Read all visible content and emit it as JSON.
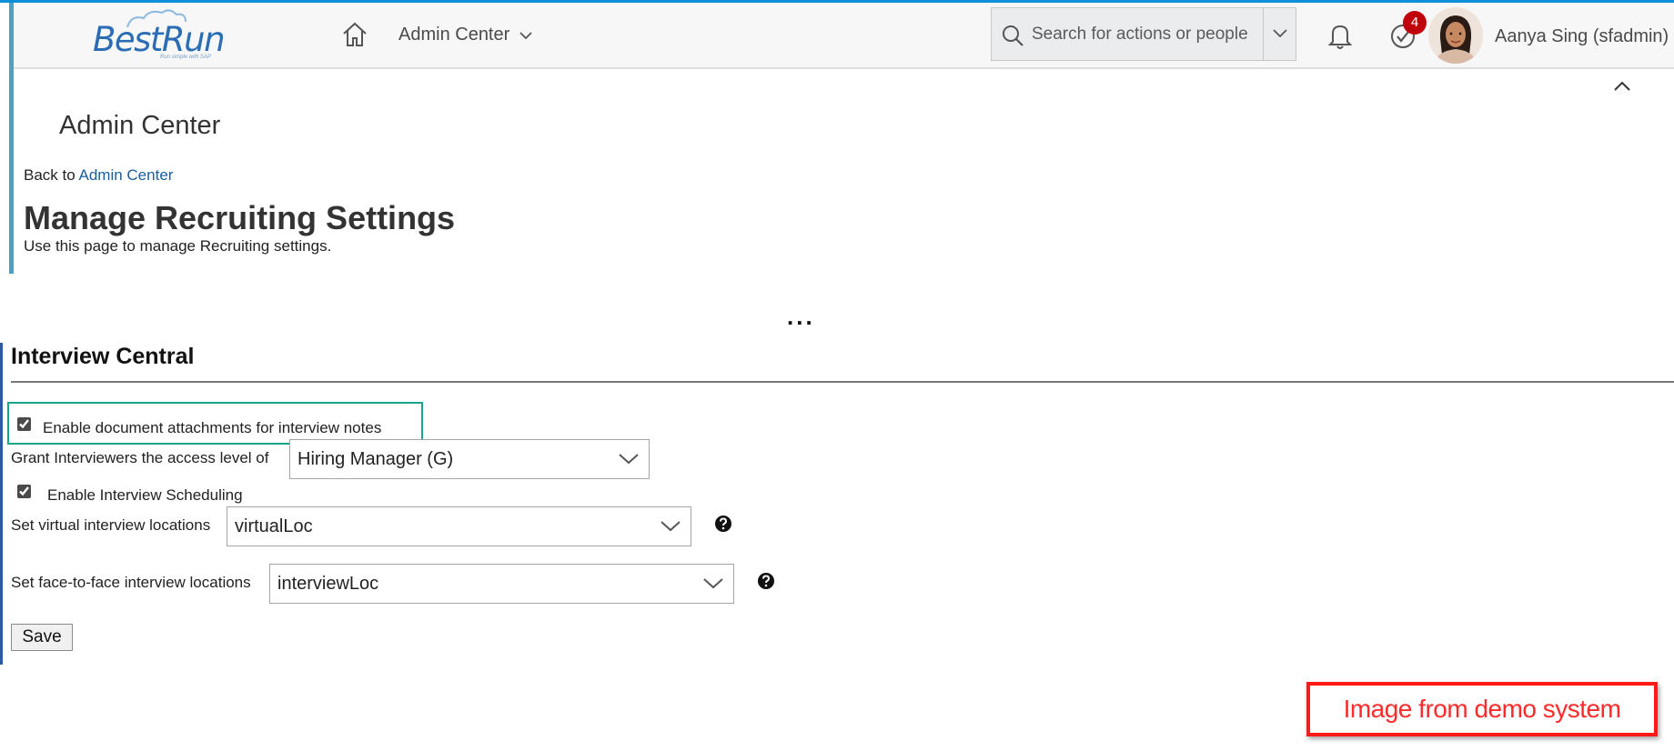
{
  "shellbar": {
    "logo_text": "BestRun",
    "logo_tagline": "Run simple with SAP",
    "nav_label": "Admin Center",
    "search_placeholder": "Search for actions or people",
    "notification_count": "4",
    "user_name": "Aanya Sing (sfadmin)"
  },
  "header": {
    "page_title": "Admin Center",
    "back_prefix": "Back to",
    "back_link": "Admin Center",
    "heading": "Manage Recruiting Settings",
    "description": "Use this page to manage Recruiting settings.",
    "ellipsis": "..."
  },
  "section": {
    "title": "Interview Central",
    "enable_attachments_label": "Enable document attachments for interview notes",
    "enable_attachments_checked": true,
    "grant_access_label": "Grant Interviewers the access level of",
    "grant_access_value": "Hiring Manager (G)",
    "enable_scheduling_label": "Enable Interview Scheduling",
    "enable_scheduling_checked": true,
    "virtual_locations_label": "Set virtual interview locations",
    "virtual_locations_value": "virtualLoc",
    "f2f_locations_label": "Set face-to-face interview locations",
    "f2f_locations_value": "interviewLoc",
    "save_label": "Save"
  },
  "banner": {
    "text": "Image from demo system"
  },
  "colors": {
    "accent_blue": "#0a8fd8",
    "link": "#1a5ea0",
    "highlight_green": "#1aa389",
    "banner_red": "#ff1a1a",
    "badge_red": "#c0000b"
  }
}
